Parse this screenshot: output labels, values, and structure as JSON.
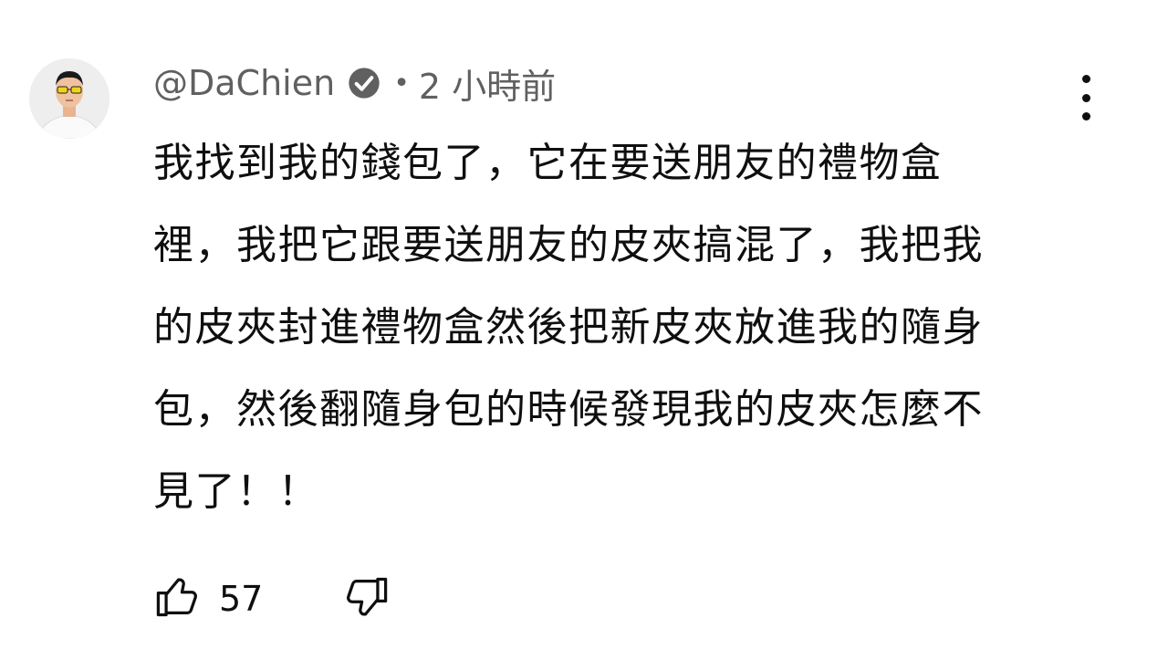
{
  "comment": {
    "author_handle": "@DaChien",
    "verified": true,
    "separator": "•",
    "time_ago": "2 小時前",
    "lines": [
      "我找到我的錢包了，它在要送朋友的禮物盒",
      "裡，我把它跟要送朋友的皮夾搞混了，我把我",
      "的皮夾封進禮物盒然後把新皮夾放進我的隨身",
      "包，然後翻隨身包的時候發現我的皮夾怎麼不",
      "見了！！"
    ],
    "like_count": "57",
    "icons": {
      "verified": "check-circle-icon",
      "menu": "more-vertical-icon",
      "like": "thumbs-up-icon",
      "dislike": "thumbs-down-icon"
    },
    "colors": {
      "meta_text": "#606060",
      "body_text": "#0f0f0f",
      "background": "#ffffff"
    }
  }
}
